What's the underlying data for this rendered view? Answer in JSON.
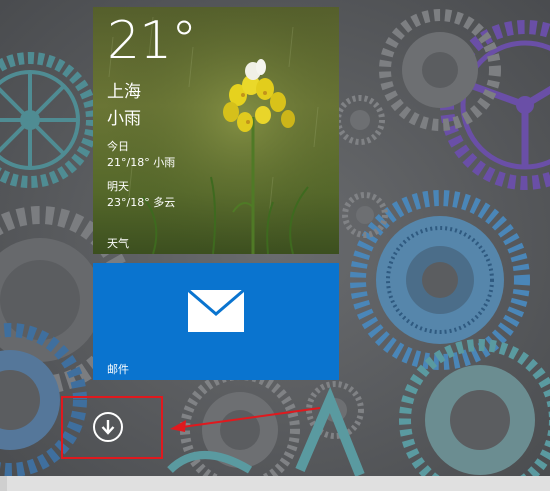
{
  "weather_tile": {
    "temperature": "21°",
    "city": "上海",
    "condition": "小雨",
    "today_label": "今日",
    "today_forecast": "21°/18° 小雨",
    "tomorrow_label": "明天",
    "tomorrow_forecast": "23°/18° 多云",
    "tile_label": "天气",
    "icon": "flower-photo"
  },
  "mail_tile": {
    "tile_label": "邮件",
    "icon": "envelope-icon",
    "color": "#0a74cf"
  },
  "apps_button": {
    "icon": "down-arrow-circle-icon"
  },
  "annotation": {
    "color": "#e0191e"
  }
}
